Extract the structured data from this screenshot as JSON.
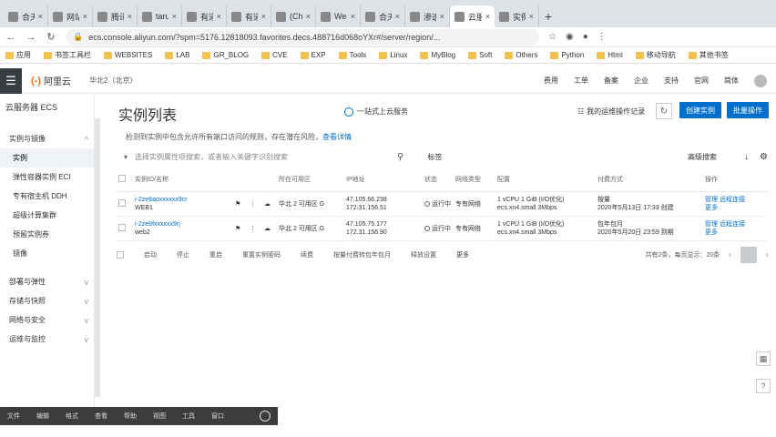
{
  "tabs": [
    {
      "label": "合天",
      "active": false
    },
    {
      "label": "网站",
      "active": false
    },
    {
      "label": "腾讯",
      "active": false
    },
    {
      "label": "tarun",
      "active": false
    },
    {
      "label": "有道",
      "active": false
    },
    {
      "label": "有道",
      "active": false
    },
    {
      "label": "(Che",
      "active": false
    },
    {
      "label": "Web",
      "active": false
    },
    {
      "label": "合天",
      "active": false
    },
    {
      "label": "渗透",
      "active": false
    },
    {
      "label": "云服",
      "active": true
    },
    {
      "label": "实例",
      "active": false
    }
  ],
  "address": {
    "url": "ecs.console.aliyun.com/?spm=5176.12818093.favorites.decs.488716d068oYXr#/server/region/..."
  },
  "bookmarks": [
    "应用",
    "书签工具栏",
    "WEBSITES",
    "LAB",
    "GR_BLOG",
    "CVE",
    "EXP",
    "Tools",
    "Linux",
    "MyBlog",
    "Soft",
    "Others",
    "Python",
    "Html",
    "移动导航",
    "其他书签"
  ],
  "console": {
    "logo_text": "阿里云",
    "region": "华北2（北京）",
    "top_links": [
      "费用",
      "工单",
      "备案",
      "企业",
      "支持",
      "官网",
      "简体"
    ]
  },
  "sidebar": {
    "title": "云服务器 ECS",
    "items": [
      {
        "label": "实例与镜像",
        "chev": "^",
        "sub": false,
        "active": false
      },
      {
        "label": "实例",
        "chev": "",
        "sub": true,
        "active": true
      },
      {
        "label": "弹性容器实例 ECI",
        "chev": "",
        "sub": true,
        "active": false
      },
      {
        "label": "专有宿主机 DDH",
        "chev": "",
        "sub": true,
        "active": false
      },
      {
        "label": "超级计算集群",
        "chev": "",
        "sub": true,
        "active": false
      },
      {
        "label": "预留实例券",
        "chev": "",
        "sub": true,
        "active": false
      },
      {
        "label": "镜像",
        "chev": "",
        "sub": true,
        "active": false
      },
      {
        "label": "部署与弹性",
        "chev": "v",
        "sub": false,
        "active": false
      },
      {
        "label": "存储与快照",
        "chev": "v",
        "sub": false,
        "active": false
      },
      {
        "label": "网络与安全",
        "chev": "v",
        "sub": false,
        "active": false
      },
      {
        "label": "运维与监控",
        "chev": "v",
        "sub": false,
        "active": false
      }
    ]
  },
  "main": {
    "title": "实例列表",
    "verify_text": "一站式上云服务",
    "ops_link": "我的运维操作记录",
    "create_btn": "创建实例",
    "batch_btn": "批量操作",
    "notice": "检测到实例中包含允许所有端口访问的规则，存在潜在风险，",
    "notice_link": "查看详情",
    "search_placeholder": "选择实例属性项搜索，或者输入关键字识别搜索",
    "tag_btn": "标签",
    "adv_search": "高级搜索",
    "columns": [
      "实例ID/名称",
      "",
      "",
      "",
      "所在可用区",
      "IP地址",
      "状态",
      "网络类型",
      "配置",
      "付费方式",
      "操作"
    ],
    "rows": [
      {
        "id": "i-2ze8aoxxxxxx9cr",
        "name": "WEB1",
        "zone": "华北 2 可用区 G",
        "ip1": "47.105.66.238",
        "ip2": "172.31.156.51",
        "status": "运行中",
        "network": "专有网络",
        "config1": "1 vCPU 1 GiB (I/O优化)",
        "config2": "ecs.xn4.small  3Mbps",
        "pay1": "按量",
        "pay2": "2020年5月13日 17:33 创建",
        "op1": "管理",
        "op2": "远程连接",
        "op3": "更多"
      },
      {
        "id": "i-2ze9fxxxxxx9rj",
        "name": "web2",
        "zone": "华北 2 可用区 G",
        "ip1": "47.105.75.177",
        "ip2": "172.31.156.90",
        "status": "运行中",
        "network": "专有网络",
        "config1": "1 vCPU 1 GiB (I/O优化)",
        "config2": "ecs.xn4.small  3Mbps",
        "pay1": "包年包月",
        "pay2": "2020年5月20日 23:59 到期",
        "op1": "管理",
        "op2": "远程连接",
        "op3": "更多"
      }
    ],
    "footer": [
      "启动",
      "停止",
      "重启",
      "重置实例密码",
      "续费",
      "按量付费转包年包月",
      "释放设置",
      "更多"
    ],
    "pager_text": "共有2条，每页显示：20条"
  },
  "taskbar": [
    "文件",
    "编辑",
    "格式",
    "查看",
    "帮助",
    "视图",
    "工具",
    "窗口"
  ]
}
